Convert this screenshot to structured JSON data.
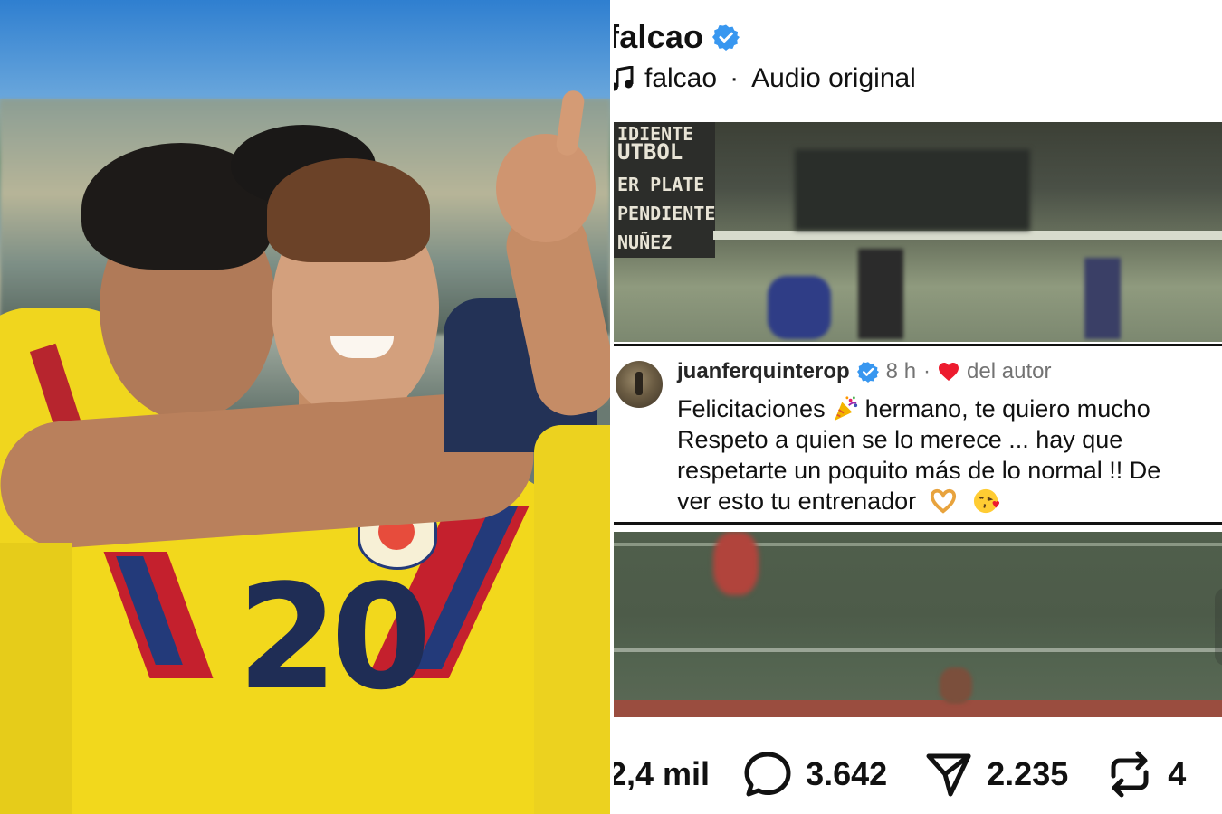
{
  "post": {
    "author": "falcao",
    "audio_author": "falcao",
    "audio_separator": "·",
    "audio_label": "Audio original"
  },
  "video_overlay": {
    "lines": [
      "IDIENTE",
      "UTBOL",
      "ER PLATE",
      "PENDIENTE",
      "NUÑEZ"
    ]
  },
  "comment": {
    "username": "juanferquinterop",
    "time": "8 h",
    "dot": "·",
    "liked_by_author_label": "del autor",
    "line1_a": "Felicitaciones",
    "line1_b": "hermano, te quiero mucho",
    "line2": "Respeto a quien se lo merece ... hay que",
    "line3": "respetarte un poquito más de lo normal !! De",
    "line4": "ver esto tu entrenador"
  },
  "stats": {
    "likes": "2,4 mil",
    "comments": "3.642",
    "shares": "2.235",
    "reposts": "4"
  },
  "photo": {
    "jersey_number": "20"
  },
  "icons": {
    "verified": "verified-badge-icon",
    "music": "music-note-icon",
    "heart": "heart-icon",
    "comment": "comment-bubble-icon",
    "share": "send-icon",
    "repost": "repost-icon",
    "party": "party-popper-emoji",
    "hands": "heart-hands-emoji",
    "kiss": "face-blowing-kiss-emoji"
  },
  "colors": {
    "verified_blue": "#3897f0",
    "heart_red": "#ed1b2e",
    "jersey_yellow": "#f2d81c"
  }
}
